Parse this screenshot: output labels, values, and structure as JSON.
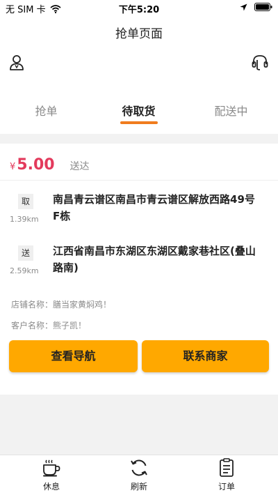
{
  "status_bar": {
    "carrier": "无 SIM 卡",
    "time": "下午5:20"
  },
  "header": {
    "title": "抢单页面"
  },
  "icons": {
    "profile": "user-icon",
    "service": "customer-service-icon"
  },
  "tabs": [
    {
      "label": "抢单",
      "active": false
    },
    {
      "label": "待取货",
      "active": true
    },
    {
      "label": "配送中",
      "active": false
    }
  ],
  "order": {
    "currency": "¥",
    "price": "5.00",
    "delivery_type": "送达",
    "pickup": {
      "tag": "取",
      "distance": "1.39km",
      "address": "南昌青云谱区南昌市青云谱区解放西路49号F栋"
    },
    "dropoff": {
      "tag": "送",
      "distance": "2.59km",
      "address": "江西省南昌市东湖区东湖区戴家巷社区(叠山路南)"
    },
    "shop_line": "店铺名称：膳当家黄焖鸡！",
    "customer_line": "客户名称：熊子凯！",
    "navigate_label": "查看导航",
    "contact_label": "联系商家"
  },
  "bottom_nav": [
    {
      "label": "休息",
      "icon": "coffee-cup-icon"
    },
    {
      "label": "刷新",
      "icon": "refresh-icon"
    },
    {
      "label": "订单",
      "icon": "order-list-icon"
    }
  ],
  "colors": {
    "accent": "#ffa800",
    "tab_indicator": "#f07c1e",
    "price": "#e33a5c"
  }
}
